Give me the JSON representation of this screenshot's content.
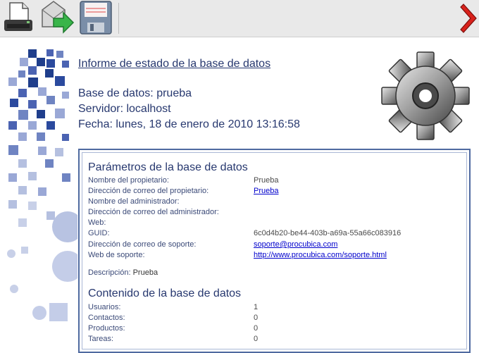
{
  "toolbar": {
    "buttons": [
      {
        "name": "print-icon"
      },
      {
        "name": "send-email-icon"
      },
      {
        "name": "save-disk-icon"
      }
    ],
    "close_icon": "red-chevron-icon"
  },
  "header": {
    "title": "Informe de estado de la base de datos",
    "database": "Base de datos: prueba",
    "server": "Servidor: localhost",
    "date": "Fecha: lunes, 18 de enero de 2010 13:16:58"
  },
  "parameters": {
    "title": "Parámetros de la base de datos",
    "rows": [
      {
        "label": "Nombre del propietario:",
        "value": "Prueba"
      },
      {
        "label": "Dirección de correo del propietario:",
        "value": "Prueba"
      },
      {
        "label": "Nombre del administrador:",
        "value": ""
      },
      {
        "label": "Dirección de correo del administrador:",
        "value": ""
      },
      {
        "label": "Web:",
        "value": ""
      },
      {
        "label": "GUID:",
        "value": "6c0d4b20-be44-403b-a69a-55a66c083916"
      },
      {
        "label": "Dirección de correo de soporte:",
        "value": "soporte@procubica.com"
      },
      {
        "label": "Web de soporte:",
        "value": "http://www.procubica.com/soporte.html"
      }
    ],
    "description_label": "Descripción:",
    "description_value": "Prueba"
  },
  "contents": {
    "title": "Contenido de la base de datos",
    "rows": [
      {
        "label": "Usuarios:",
        "value": "1"
      },
      {
        "label": "Contactos:",
        "value": "0"
      },
      {
        "label": "Productos:",
        "value": "0"
      },
      {
        "label": "Tareas:",
        "value": "0"
      }
    ]
  },
  "colors": {
    "accent": "#27386f",
    "box_border": "#4f6aa0",
    "link": "#0000cc"
  }
}
